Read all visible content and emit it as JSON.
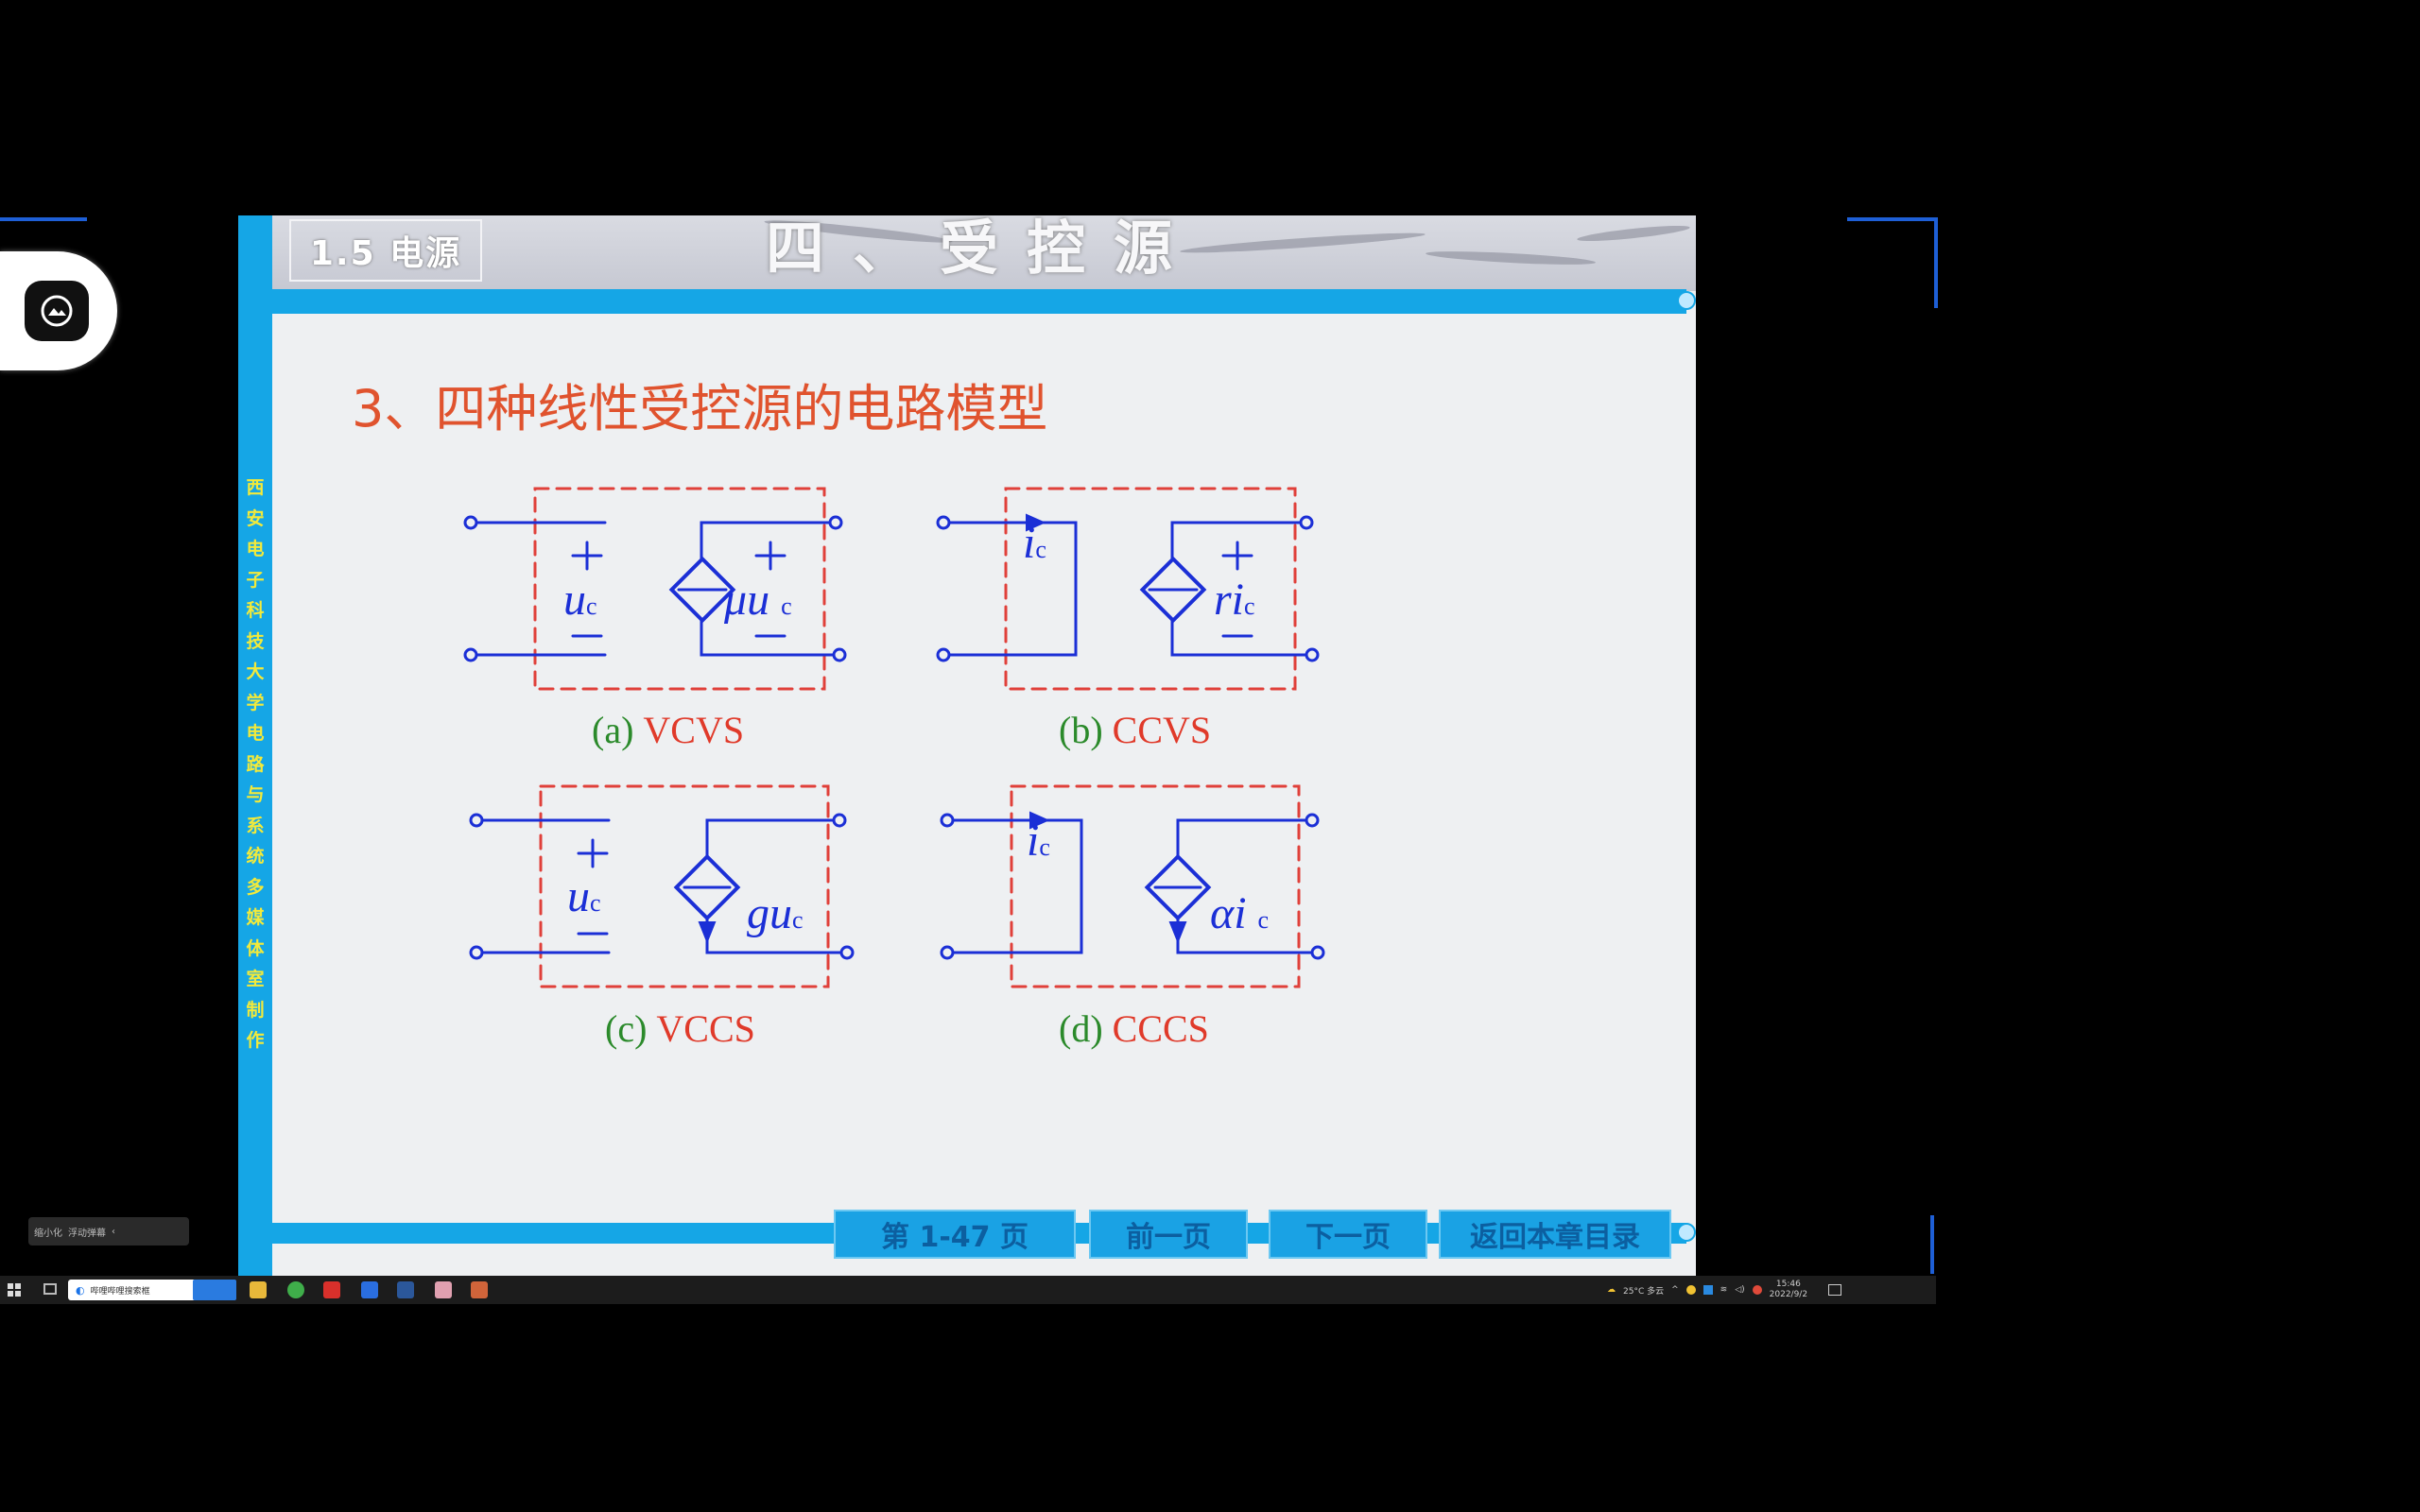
{
  "slide": {
    "section_tag": "1.5 电源",
    "header_title": "四、受控源",
    "left_rail_text": [
      "西",
      "安",
      "电",
      "子",
      "科",
      "技",
      "大",
      "学",
      "电",
      "路",
      "与",
      "系",
      "统",
      "多",
      "媒",
      "体",
      "室",
      "制",
      "作"
    ],
    "heading": "3、四种线性受控源的电路模型",
    "diagrams": {
      "a": {
        "label": "(a)",
        "type": "VCVS",
        "control_var": "u",
        "control_sub": "c",
        "source_expr": "μu",
        "source_sub": "c",
        "plus": "+",
        "minus": "−"
      },
      "b": {
        "label": "(b)",
        "type": "CCVS",
        "control_var": "i",
        "control_sub": "c",
        "source_expr": "ri",
        "source_sub": "c",
        "plus": "+",
        "minus": "−"
      },
      "c": {
        "label": "(c)",
        "type": "VCCS",
        "control_var": "u",
        "control_sub": "c",
        "source_expr": "gu",
        "source_sub": "c",
        "plus": "+",
        "minus": "−"
      },
      "d": {
        "label": "(d)",
        "type": "CCCS",
        "control_var": "i",
        "control_sub": "c",
        "source_expr": "αi",
        "source_sub": "c"
      }
    },
    "nav": {
      "page_label": "第 1-47 页",
      "prev_label": "前一页",
      "next_label": "下一页",
      "back_label": "返回本章目录"
    }
  },
  "colors": {
    "circuit": "#1b2fd6",
    "dashed_box": "#e0403a",
    "rail": "#15a6e6",
    "heading": "#e0532e",
    "caption_letter": "#2b8a2b",
    "caption_type": "#e03a2a"
  },
  "taskbar": {
    "search_text": "哔哩哔哩搜索框",
    "weather": "25°C 多云",
    "clock_time": "15:46",
    "clock_date": "2022/9/2"
  },
  "mini_bar": {
    "item1": "缩小化",
    "item2": "浮动弹幕"
  }
}
